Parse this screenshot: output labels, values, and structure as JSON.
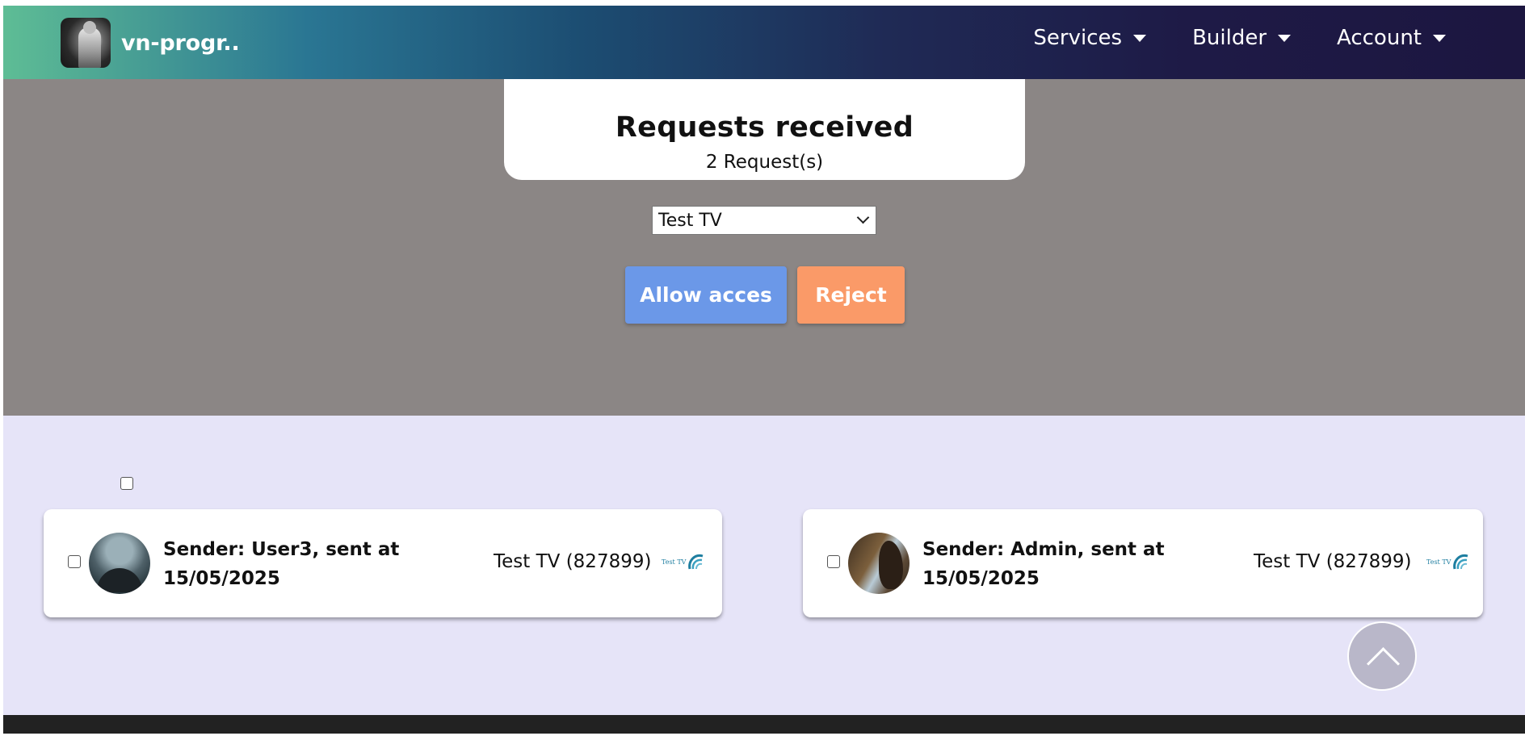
{
  "brand": {
    "name": "vn-progr.."
  },
  "nav": {
    "items": [
      {
        "label": "Services"
      },
      {
        "label": "Builder"
      },
      {
        "label": "Account"
      }
    ]
  },
  "hero": {
    "title": "Requests received",
    "count": "2 Request(s)",
    "select": {
      "selected": "Test TV"
    },
    "allow_label": "Allow acces",
    "reject_label": "Reject"
  },
  "requests": [
    {
      "sender_line1": "Sender: User3, sent at",
      "sender_line2": "15/05/2025",
      "channel": "Test TV (827899)",
      "logo_text": "Test TV"
    },
    {
      "sender_line1": "Sender: Admin, sent at",
      "sender_line2": "15/05/2025",
      "channel": "Test TV (827899)",
      "logo_text": "Test TV"
    }
  ],
  "colors": {
    "hero_bg": "#8b8685",
    "list_bg": "#e6e4f8",
    "allow": "#6b98e8",
    "reject": "#fa9a68",
    "footer": "#222222"
  }
}
